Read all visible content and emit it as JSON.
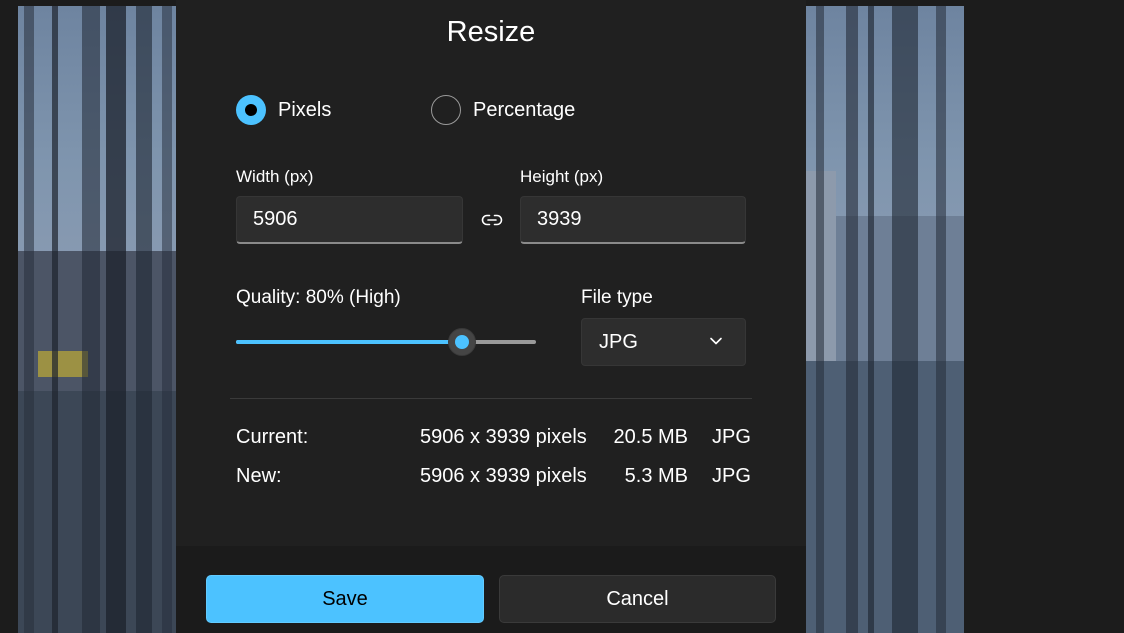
{
  "dialog": {
    "title": "Resize",
    "mode_options": [
      {
        "label": "Pixels",
        "selected": true
      },
      {
        "label": "Percentage",
        "selected": false
      }
    ],
    "width": {
      "label": "Width  (px)",
      "value": "5906"
    },
    "height": {
      "label": "Height  (px)",
      "value": "3939"
    },
    "aspect_lock_icon": "link-icon",
    "quality": {
      "label": "Quality: 80% (High)",
      "value_percent": 80
    },
    "file_type": {
      "label": "File type",
      "selected": "JPG"
    },
    "info": {
      "current": {
        "label": "Current:",
        "dimensions": "5906 x 3939 pixels",
        "size": "20.5 MB",
        "format": "JPG"
      },
      "new": {
        "label": "New:",
        "dimensions": "5906 x 3939 pixels",
        "size": "5.3 MB",
        "format": "JPG"
      }
    },
    "buttons": {
      "save": "Save",
      "cancel": "Cancel"
    }
  },
  "colors": {
    "accent": "#4cc2ff",
    "dialog_bg": "#202020",
    "control_bg": "#2d2d2d",
    "text": "#ffffff"
  }
}
